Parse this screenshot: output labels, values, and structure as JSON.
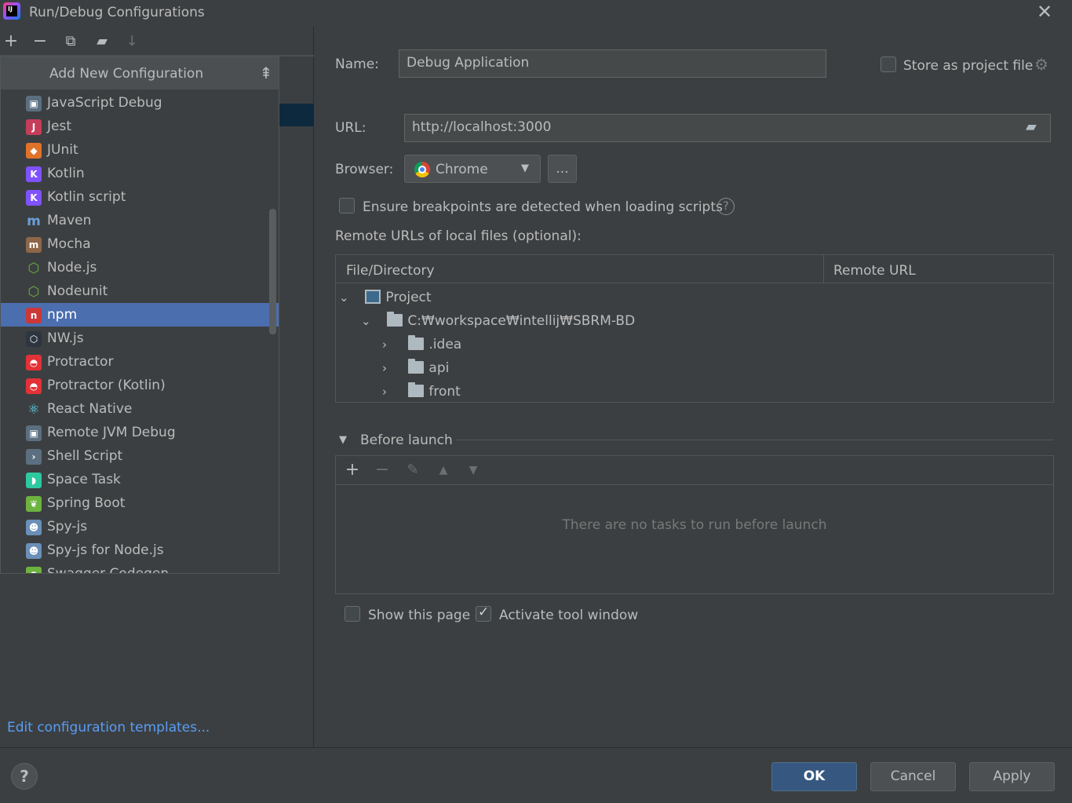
{
  "window": {
    "title": "Run/Debug Configurations",
    "close_icon": "close-icon"
  },
  "left_toolbar": {
    "icons": [
      "add-icon",
      "remove-icon",
      "copy-icon",
      "new-folder-icon",
      "sort-icon"
    ]
  },
  "popup": {
    "title": "Add New Configuration",
    "items": [
      {
        "label": "JavaScript Debug",
        "icon": "javascript-debug-icon"
      },
      {
        "label": "Jest",
        "icon": "jest-icon"
      },
      {
        "label": "JUnit",
        "icon": "junit-icon"
      },
      {
        "label": "Kotlin",
        "icon": "kotlin-icon"
      },
      {
        "label": "Kotlin script",
        "icon": "kotlin-script-icon"
      },
      {
        "label": "Maven",
        "icon": "maven-icon"
      },
      {
        "label": "Mocha",
        "icon": "mocha-icon"
      },
      {
        "label": "Node.js",
        "icon": "nodejs-icon"
      },
      {
        "label": "Nodeunit",
        "icon": "nodeunit-icon"
      },
      {
        "label": "npm",
        "icon": "npm-icon",
        "selected": true
      },
      {
        "label": "NW.js",
        "icon": "nwjs-icon"
      },
      {
        "label": "Protractor",
        "icon": "protractor-icon"
      },
      {
        "label": "Protractor (Kotlin)",
        "icon": "protractor-kotlin-icon"
      },
      {
        "label": "React Native",
        "icon": "react-native-icon"
      },
      {
        "label": "Remote JVM Debug",
        "icon": "remote-jvm-debug-icon"
      },
      {
        "label": "Shell Script",
        "icon": "shell-script-icon"
      },
      {
        "label": "Space Task",
        "icon": "space-task-icon"
      },
      {
        "label": "Spring Boot",
        "icon": "spring-boot-icon"
      },
      {
        "label": "Spy-js",
        "icon": "spy-js-icon"
      },
      {
        "label": "Spy-js for Node.js",
        "icon": "spy-js-node-icon"
      },
      {
        "label": "Swagger Codegen",
        "icon": "swagger-codegen-icon"
      }
    ]
  },
  "edit_templates_link": "Edit configuration templates...",
  "form": {
    "name_label": "Name:",
    "name_value": "Debug Application",
    "store_label": "Store as project file",
    "url_label": "URL:",
    "url_value": "http://localhost:3000",
    "browser_label": "Browser:",
    "browser_value": "Chrome",
    "browse_button": "...",
    "ensure_label": "Ensure breakpoints are detected when loading scripts",
    "remote_urls_label": "Remote URLs of local files (optional):"
  },
  "remote_table": {
    "columns": [
      "File/Directory",
      "Remote URL"
    ],
    "rows": [
      {
        "label": "Project",
        "expanded": true
      },
      {
        "label": "C:₩workspace₩intellij₩SBRM-BD",
        "expanded": true
      },
      {
        "label": ".idea",
        "expanded": false
      },
      {
        "label": "api",
        "expanded": false
      },
      {
        "label": "front",
        "expanded": false
      }
    ]
  },
  "before_launch": {
    "title": "Before launch",
    "empty_text": "There are no tasks to run before launch"
  },
  "options": {
    "show_page_label": "Show this page",
    "show_page_checked": false,
    "activate_tool_label": "Activate tool window",
    "activate_tool_checked": true
  },
  "footer": {
    "ok": "OK",
    "cancel": "Cancel",
    "apply": "Apply",
    "help": "?"
  },
  "colors": {
    "background": "#3c3f41",
    "selection": "#4b6eaf",
    "link": "#589df6",
    "primary_button": "#365880"
  }
}
